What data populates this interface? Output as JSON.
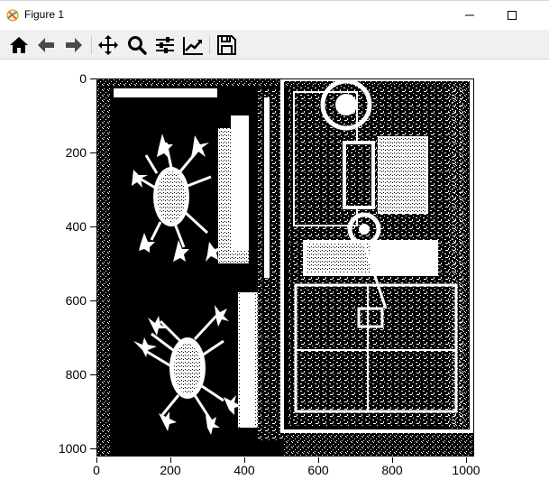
{
  "window": {
    "title": "Figure 1",
    "minimize_glyph": "—",
    "maximize_glyph": "☐"
  },
  "toolbar": {
    "buttons": [
      {
        "name": "home",
        "icon": "home-icon"
      },
      {
        "name": "back",
        "icon": "arrow-left-icon"
      },
      {
        "name": "forward",
        "icon": "arrow-right-icon"
      },
      {
        "name": "pan",
        "icon": "move-icon"
      },
      {
        "name": "zoom",
        "icon": "magnifier-icon"
      },
      {
        "name": "configure-subplots",
        "icon": "sliders-icon"
      },
      {
        "name": "edit-axes",
        "icon": "line-chart-icon"
      },
      {
        "name": "save",
        "icon": "floppy-disk-icon"
      }
    ]
  },
  "axes": {
    "y_ticks": [
      "0",
      "200",
      "400",
      "600",
      "800",
      "1000"
    ],
    "x_ticks": [
      "0",
      "200",
      "400",
      "600",
      "800",
      "1000"
    ],
    "image": "binary black-and-white thresholded aerial image of an airport with two terminal buildings and aircraft on the left and a rectangular structured complex on the right"
  },
  "colors": {
    "background": "#000000",
    "foreground": "#ffffff",
    "toolbar": "#f0f0f0"
  }
}
